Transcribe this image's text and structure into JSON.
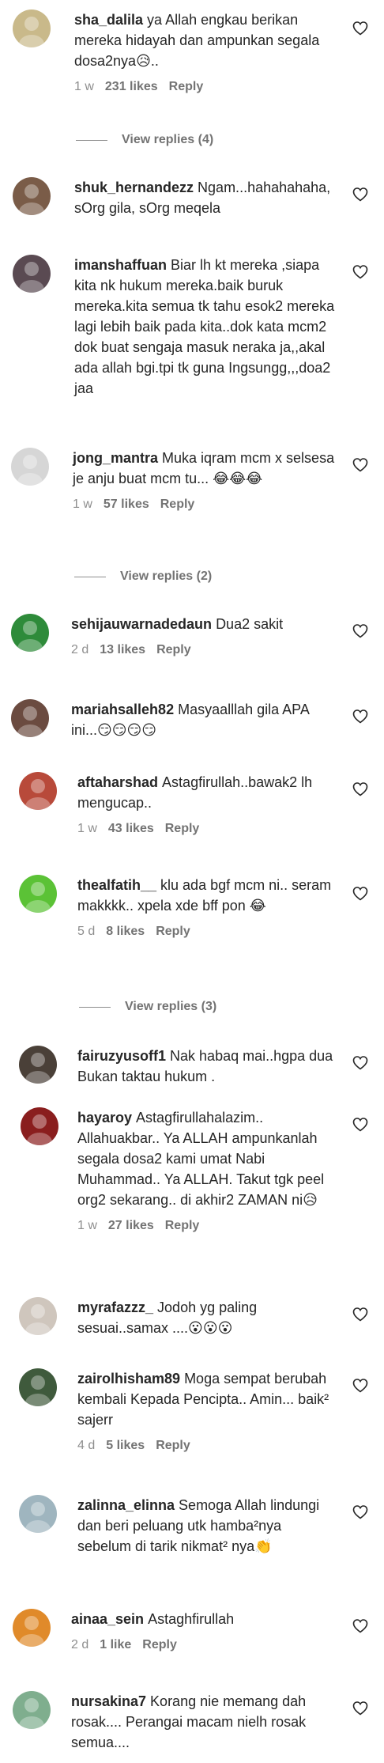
{
  "comments": [
    {
      "user": "sha_dalila",
      "text": "ya Allah engkau berikan mereka hidayah dan ampunkan segala dosa2nya😥..",
      "time": "1 w",
      "likes": "231 likes",
      "reply": "Reply",
      "view_replies": "View replies (4)",
      "avatar_color": "#c9b98a"
    },
    {
      "user": "shuk_hernandezz",
      "text": "Ngam...hahahahaha, sOrg gila, sOrg meqela",
      "time": "",
      "likes": "",
      "reply": "",
      "view_replies": "",
      "avatar_color": "#7a5c48"
    },
    {
      "user": "imanshaffuan",
      "text": "Biar lh kt mereka ,siapa kita nk hukum mereka.baik buruk mereka.kita semua tk tahu esok2 mereka lagi lebih baik pada kita..dok kata mcm2 dok buat sengaja masuk neraka ja,,akal ada allah bgi.tpi tk guna Ingsungg,,,doa2 jaa",
      "time": "",
      "likes": "",
      "reply": "",
      "view_replies": "",
      "avatar_color": "#5a4a52"
    },
    {
      "user": "jong_mantra",
      "text": "Muka iqram mcm x selsesa je anju buat mcm tu... 😂😂😂",
      "time": "1 w",
      "likes": "57 likes",
      "reply": "Reply",
      "view_replies": "View replies (2)",
      "avatar_color": "#d6d6d6"
    },
    {
      "user": "sehijauwarnadedaun",
      "text": "Dua2 sakit",
      "time": "2 d",
      "likes": "13 likes",
      "reply": "Reply",
      "view_replies": "",
      "avatar_color": "#2e8b3a"
    },
    {
      "user": "mariahsalleh82",
      "text": "Masyaalllah gila APA ini...😏😏😏😏",
      "time": "",
      "likes": "",
      "reply": "",
      "view_replies": "",
      "avatar_color": "#6b4b40"
    },
    {
      "user": "aftaharshad",
      "text": "Astagfirullah..bawak2 lh mengucap..",
      "time": "1 w",
      "likes": "43 likes",
      "reply": "Reply",
      "view_replies": "",
      "avatar_color": "#b84a3a"
    },
    {
      "user": "thealfatih__",
      "text": "klu ada bgf mcm ni.. seram makkkk.. xpela xde bff pon 😂",
      "time": "5 d",
      "likes": "8 likes",
      "reply": "Reply",
      "view_replies": "View replies (3)",
      "avatar_color": "#5bc236"
    },
    {
      "user": "fairuzyusoff1",
      "text": "Nak habaq mai..hgpa dua Bukan taktau hukum .",
      "time": "",
      "likes": "",
      "reply": "",
      "view_replies": "",
      "avatar_color": "#4a4038"
    },
    {
      "user": "hayaroy",
      "text": "Astagfirullahalazim.. Allahuakbar.. Ya ALLAH ampunkanlah segala dosa2 kami umat Nabi Muhammad.. Ya ALLAH. Takut tgk peel org2 sekarang.. di akhir2 ZAMAN ni😥",
      "time": "1 w",
      "likes": "27 likes",
      "reply": "Reply",
      "view_replies": "",
      "avatar_color": "#8a1e1e"
    },
    {
      "user": "myrafazzz_",
      "text": "Jodoh yg paling sesuai..samax ....😮😮😮",
      "time": "",
      "likes": "",
      "reply": "",
      "view_replies": "",
      "avatar_color": "#cfc6bd"
    },
    {
      "user": "zairolhisham89",
      "text": "Moga sempat berubah kembali Kepada Pencipta.. Amin... baik² sajerr",
      "time": "4 d",
      "likes": "5 likes",
      "reply": "Reply",
      "view_replies": "",
      "avatar_color": "#3f5a3c"
    },
    {
      "user": "zalinna_elinna",
      "text": "Semoga Allah lindungi dan beri peluang utk hamba²nya sebelum di tarik nikmat² nya👏",
      "time": "",
      "likes": "",
      "reply": "",
      "view_replies": "",
      "avatar_color": "#9fb5bf"
    },
    {
      "user": "ainaa_sein",
      "text": "Astaghfirullah",
      "time": "2 d",
      "likes": "1 like",
      "reply": "Reply",
      "view_replies": "",
      "avatar_color": "#e08a2a"
    },
    {
      "user": "nursakina7",
      "text": "Korang nie memang dah rosak.... Perangai macam nielh rosak semua....",
      "time": "",
      "likes": "",
      "reply": "",
      "view_replies": "",
      "avatar_color": "#7fae8e"
    }
  ]
}
